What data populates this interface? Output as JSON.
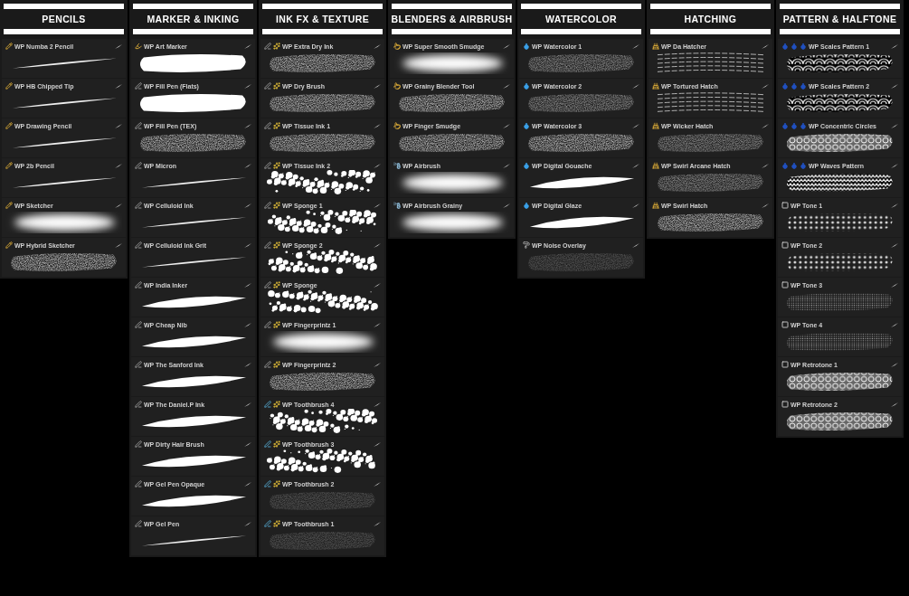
{
  "columns": [
    {
      "title": "PENCILS",
      "brushes": [
        {
          "name": "WP Numba 2 Pencil",
          "kind": "thin"
        },
        {
          "name": "WP HB Chipped Tip",
          "kind": "thin"
        },
        {
          "name": "WP Drawing Pencil",
          "kind": "thin"
        },
        {
          "name": "WP 2b Pencil",
          "kind": "thin"
        },
        {
          "name": "WP Sketcher",
          "kind": "soft"
        },
        {
          "name": "WP Hybrid Sketcher",
          "kind": "grain"
        }
      ]
    },
    {
      "title": "MARKER & INKING",
      "brushes": [
        {
          "name": "WP Art Marker",
          "kind": "fat"
        },
        {
          "name": "WP Fill Pen (Flats)",
          "kind": "fat"
        },
        {
          "name": "WP Fill Pen (TEX)",
          "kind": "grain"
        },
        {
          "name": "WP Micron",
          "kind": "thin"
        },
        {
          "name": "WP Celluloid Ink",
          "kind": "thin"
        },
        {
          "name": "WP Celluloid Ink Grit",
          "kind": "thin"
        },
        {
          "name": "WP India Inker",
          "kind": "taper"
        },
        {
          "name": "WP Cheap Nib",
          "kind": "taper"
        },
        {
          "name": "WP The Sanford Ink",
          "kind": "taper"
        },
        {
          "name": "WP The Daniel.P Ink",
          "kind": "taper"
        },
        {
          "name": "WP Dirty Hair Brush",
          "kind": "taper"
        },
        {
          "name": "WP Gel Pen Opaque",
          "kind": "taper"
        },
        {
          "name": "WP Gel Pen",
          "kind": "thin"
        }
      ]
    },
    {
      "title": "INK FX & TEXTURE",
      "brushes": [
        {
          "name": "WP Extra Dry Ink",
          "kind": "grain"
        },
        {
          "name": "WP Dry Brush",
          "kind": "grain"
        },
        {
          "name": "WP Tissue Ink 1",
          "kind": "grain"
        },
        {
          "name": "WP Tissue Ink 2",
          "kind": "splatter"
        },
        {
          "name": "WP Sponge 1",
          "kind": "splatter"
        },
        {
          "name": "WP Sponge 2",
          "kind": "splatter"
        },
        {
          "name": "WP Sponge",
          "kind": "splatter"
        },
        {
          "name": "WP Fingerprintz 1",
          "kind": "soft"
        },
        {
          "name": "WP Fingerprintz 2",
          "kind": "grain"
        },
        {
          "name": "WP Toothbrush 4",
          "kind": "splatter"
        },
        {
          "name": "WP Toothbrush 3",
          "kind": "splatter"
        },
        {
          "name": "WP Toothbrush 2",
          "kind": "faint"
        },
        {
          "name": "WP Toothbrush 1",
          "kind": "faint"
        }
      ]
    },
    {
      "title": "BLENDERS & AIRBRUSH",
      "brushes": [
        {
          "name": "WP Super Smooth Smudge",
          "kind": "soft"
        },
        {
          "name": "WP Grainy Blender Tool",
          "kind": "grain"
        },
        {
          "name": "WP Finger Smudge",
          "kind": "grain"
        },
        {
          "name": "WP Airbrush",
          "kind": "soft"
        },
        {
          "name": "WP Airbrush Grainy",
          "kind": "soft"
        }
      ]
    },
    {
      "title": "WATERCOLOR",
      "brushes": [
        {
          "name": "WP Watercolor 1",
          "kind": "wash"
        },
        {
          "name": "WP Watercolor 2",
          "kind": "wash"
        },
        {
          "name": "WP Watercolor 3",
          "kind": "grain"
        },
        {
          "name": "WP Digital Gouache",
          "kind": "taper"
        },
        {
          "name": "WP Digital Glaze",
          "kind": "taper"
        },
        {
          "name": "WP Noise Overlay",
          "kind": "faint"
        }
      ]
    },
    {
      "title": "HATCHING",
      "brushes": [
        {
          "name": "WP Da Hatcher",
          "kind": "hatch"
        },
        {
          "name": "WP Tortured Hatch",
          "kind": "hatch"
        },
        {
          "name": "WP Wicker Hatch",
          "kind": "wash"
        },
        {
          "name": "WP Swirl Arcane Hatch",
          "kind": "wash"
        },
        {
          "name": "WP Swirl Hatch",
          "kind": "grain"
        }
      ]
    },
    {
      "title": "PATTERN & HALFTONE",
      "brushes": [
        {
          "name": "WP Scales Pattern 1",
          "kind": "scales"
        },
        {
          "name": "WP Scales Pattern 2",
          "kind": "scales"
        },
        {
          "name": "WP Concentric Circles",
          "kind": "circles"
        },
        {
          "name": "WP Waves Pattern",
          "kind": "waves"
        },
        {
          "name": "WP Tone 1",
          "kind": "dots"
        },
        {
          "name": "WP Tone 2",
          "kind": "dots"
        },
        {
          "name": "WP Tone 3",
          "kind": "finedots"
        },
        {
          "name": "WP Tone 4",
          "kind": "finedots"
        },
        {
          "name": "WP Retrotone 1",
          "kind": "circles"
        },
        {
          "name": "WP Retrotone 2",
          "kind": "circles"
        }
      ]
    }
  ]
}
